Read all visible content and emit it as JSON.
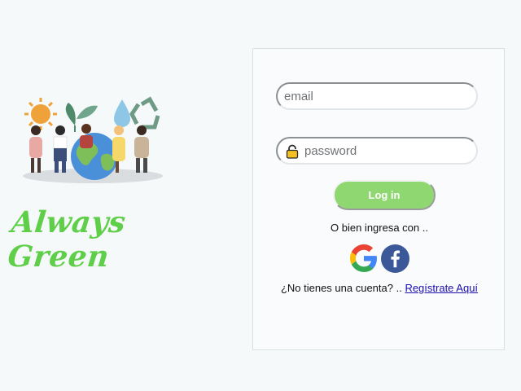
{
  "brand": {
    "title": "Always Green",
    "title_color": "#5fcf4a",
    "illustration": "people-holding-earth-sun-plant-water-recycle-illustration"
  },
  "login": {
    "email_placeholder": "email",
    "password_placeholder": "password",
    "password_icon": "lock-icon",
    "login_label": "Log in",
    "login_color": "#8fd871",
    "alt_text": "O bien ingresa con ..",
    "social": [
      {
        "name": "google",
        "icon": "google-icon"
      },
      {
        "name": "facebook",
        "icon": "facebook-icon",
        "color": "#3b5998"
      }
    ],
    "signup_prompt": "¿No tienes una cuenta? ..",
    "signup_link": "Regístrate Aquí"
  }
}
